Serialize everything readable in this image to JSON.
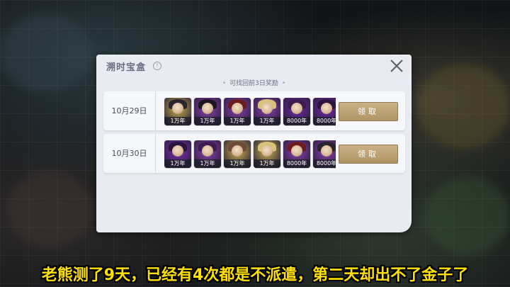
{
  "panel": {
    "title": "溯时宝盒",
    "info_glyph": "!",
    "subtitle": "可找回前3日奖励",
    "subtitle_dots": [
      "•",
      "•"
    ]
  },
  "rows": [
    {
      "date": "10月29日",
      "claim_label": "领取",
      "rewards": [
        {
          "amount": "1万年",
          "tint": "#c7b24a",
          "hair": "#2a2430"
        },
        {
          "amount": "1万年",
          "tint": "#8a3fb0",
          "hair": "#1c1622"
        },
        {
          "amount": "1万年",
          "tint": "#8a3fb0",
          "hair": "#6b1c20"
        },
        {
          "amount": "1万年",
          "tint": "#8a3fb0",
          "hair": "#d8c27a"
        },
        {
          "amount": "8000年",
          "tint": "#6d2aa8",
          "hair": "#3d1c50"
        },
        {
          "amount": "8000年",
          "tint": "#6d2aa8",
          "hair": "#2b1540"
        }
      ]
    },
    {
      "date": "10月30日",
      "claim_label": "领取",
      "rewards": [
        {
          "amount": "1万年",
          "tint": "#7a2fb0",
          "hair": "#2b1540"
        },
        {
          "amount": "1万年",
          "tint": "#8a3fb0",
          "hair": "#3d1c50"
        },
        {
          "amount": "1万年",
          "tint": "#c7b24a",
          "hair": "#6b4a3a"
        },
        {
          "amount": "1万年",
          "tint": "#c7b24a",
          "hair": "#d8c27a"
        },
        {
          "amount": "8000年",
          "tint": "#8a3fb0",
          "hair": "#6b1c20"
        },
        {
          "amount": "8000年",
          "tint": "#8a3fb0",
          "hair": "#2a2430"
        }
      ]
    }
  ],
  "caption": "老熊测了9天，已经有4次都是不派遣，第二天却出不了金子了",
  "colors": {
    "panel_bg": "#e9ebf2",
    "claim_button": "#b09566",
    "caption": "#ffe000"
  },
  "icons": {
    "close": "close-icon",
    "info": "info-icon"
  }
}
